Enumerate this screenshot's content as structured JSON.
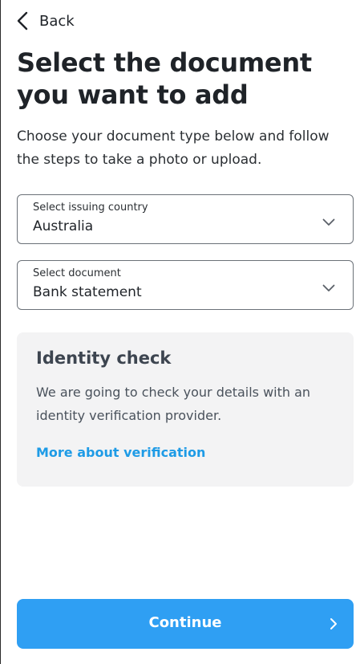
{
  "header": {
    "back_label": "Back",
    "back_icon": "chevron-left-icon"
  },
  "page": {
    "title": "Select the document you want to add",
    "subtitle": "Choose your document type below and follow the steps to take a photo or upload."
  },
  "country_select": {
    "caption": "Select issuing country",
    "value": "Australia"
  },
  "document_select": {
    "caption": "Select document",
    "value": "Bank statement"
  },
  "info_card": {
    "title": "Identity check",
    "body": "We are going to check your details with an identity verification provider.",
    "link_label": "More about verification"
  },
  "footer": {
    "continue_label": "Continue"
  },
  "colors": {
    "primary": "#2f9ff3",
    "link": "#1e9be6",
    "card_bg": "#f3f3f4",
    "text": "#1f2328"
  }
}
